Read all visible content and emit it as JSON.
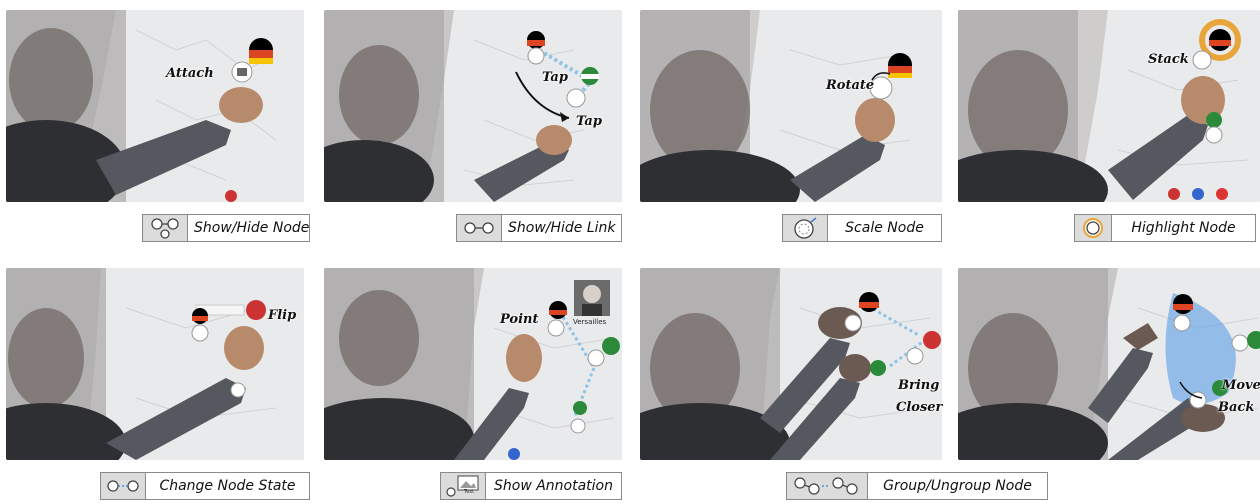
{
  "panels": [
    {
      "gestures": [
        "Attach"
      ],
      "caption": "Show/Hide Node",
      "icon": "show-hide-node-icon"
    },
    {
      "gestures": [
        "Tap",
        "Tap"
      ],
      "caption": "Show/Hide Link",
      "icon": "show-hide-link-icon"
    },
    {
      "gestures": [
        "Rotate"
      ],
      "caption": "Scale Node",
      "icon": "scale-node-icon"
    },
    {
      "gestures": [
        "Stack"
      ],
      "caption": "Highlight Node",
      "icon": "highlight-node-icon"
    },
    {
      "gestures": [
        "Flip"
      ],
      "caption": "Change Node State",
      "icon": "change-node-state-icon"
    },
    {
      "gestures": [
        "Point"
      ],
      "caption": "Show Annotation",
      "icon": "show-annotation-icon",
      "icon_text": "Text"
    },
    {
      "gestures": [
        "Bring",
        "Closer"
      ],
      "caption": "Group/Ungroup Node",
      "icon": "group-ungroup-node-icon"
    },
    {
      "gestures": [
        "Move",
        "Back"
      ],
      "caption": "",
      "icon": ""
    }
  ],
  "photo_overlays": {
    "annotation_label": "Versailles"
  },
  "colors": {
    "wall": "#e9eaec",
    "shirt": "#2e2f33",
    "arm": "#55585e",
    "skin": "#b88a6c",
    "link": "#8fc3e6",
    "group_hull": "#5a9fe6",
    "highlight_ring": "#e8a53a",
    "caption_border": "#8a8a8a",
    "icon_bg": "#dcdcdc"
  }
}
